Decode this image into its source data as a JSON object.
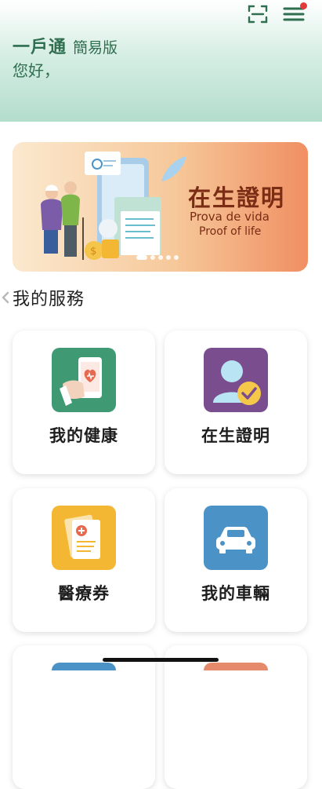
{
  "header": {
    "title": "一戶通",
    "subtitle": "簡易版",
    "greeting": "您好，",
    "icons": [
      "scan-icon",
      "menu-icon"
    ],
    "has_notification": true
  },
  "banner": {
    "title": "在生證明",
    "subtitle_pt": "Prova de vida",
    "subtitle_en": "Proof of life",
    "slide_count": 5,
    "active_slide": 1
  },
  "services": {
    "title": "我的服務",
    "items": [
      {
        "label": "我的健康",
        "icon": "health-phone-heart-icon",
        "color": "#3f9a74"
      },
      {
        "label": "在生證明",
        "icon": "person-check-icon",
        "color": "#7a4e8e"
      },
      {
        "label": "醫療券",
        "icon": "medical-voucher-icon",
        "color": "#f3b733"
      },
      {
        "label": "我的車輛",
        "icon": "car-icon",
        "color": "#4b93c6"
      }
    ]
  },
  "colors": {
    "brand_green": "#2f6e4f",
    "banner_text": "#7a2c14",
    "notification": "#e23b3b"
  }
}
